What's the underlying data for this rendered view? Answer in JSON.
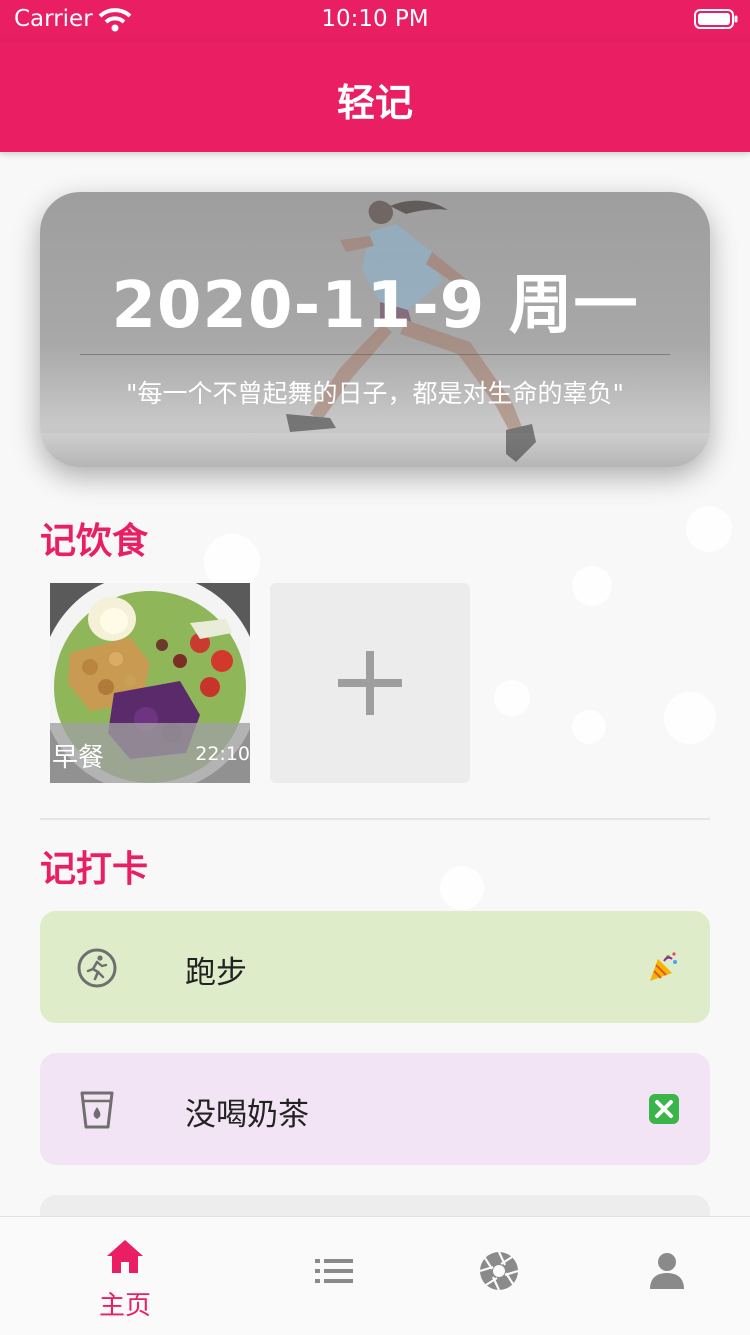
{
  "status_bar": {
    "carrier": "Carrier",
    "time": "10:10 PM"
  },
  "header": {
    "title": "轻记"
  },
  "hero": {
    "date": "2020-11-9 周一",
    "quote": "\"每一个不曾起舞的日子，都是对生命的辜负\""
  },
  "diet": {
    "title": "记饮食",
    "meals": [
      {
        "name": "早餐",
        "time": "22:10"
      }
    ],
    "add_icon": "plus-icon"
  },
  "checkin": {
    "title": "记打卡",
    "items": [
      {
        "label": "跑步",
        "icon": "running-icon",
        "status_icon": "party-popper-icon",
        "color": "#deecc9"
      },
      {
        "label": "没喝奶茶",
        "icon": "cup-icon",
        "status_icon": "cross-mark-icon",
        "color": "#f3e4f5"
      }
    ]
  },
  "tabbar": {
    "accent": "#e91e63",
    "tabs": [
      {
        "label": "主页",
        "icon": "home-icon",
        "active": true
      },
      {
        "label": "",
        "icon": "list-icon",
        "active": false
      },
      {
        "label": "",
        "icon": "camera-aperture-icon",
        "active": false
      },
      {
        "label": "",
        "icon": "person-icon",
        "active": false
      }
    ]
  }
}
